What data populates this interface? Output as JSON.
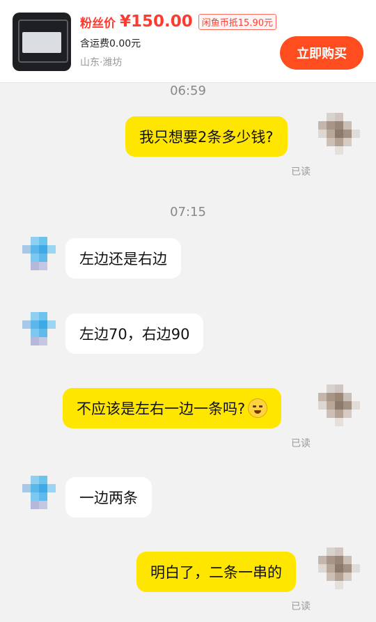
{
  "product": {
    "price_label": "粉丝价",
    "price": "¥150.00",
    "coin_deduction": "闲鱼币抵15.90元",
    "shipping": "含运费0.00元",
    "location": "山东·潍坊",
    "buy_button": "立即购买"
  },
  "chat": {
    "time_1": "06:59",
    "msg_1": "我只想要2条多少钱?",
    "read_1": "已读",
    "time_2": "07:15",
    "msg_2": "左边还是右边",
    "msg_3": "左边70，右边90",
    "msg_4": "不应该是左右一边一条吗?",
    "msg_4_emoji": "crying-laughing-emoji",
    "read_2": "已读",
    "msg_5": "一边两条",
    "msg_6": "明白了，二条一串的",
    "read_3": "已读"
  },
  "colors": {
    "accent_red": "#ff3b30",
    "buy_button": "#ff4d20",
    "my_bubble": "#ffe600",
    "their_bubble": "#ffffff",
    "background": "#f2f2f2"
  }
}
